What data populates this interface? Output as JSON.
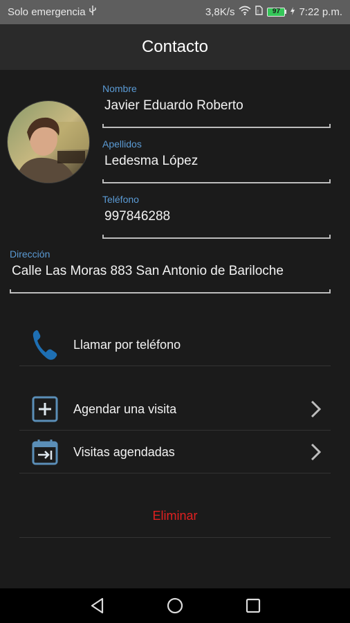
{
  "status_bar": {
    "carrier": "Solo emergencia",
    "speed": "3,8K/s",
    "battery": "97",
    "battery_level": 0.97,
    "time": "7:22 p.m."
  },
  "header": {
    "title": "Contacto"
  },
  "avatar": {
    "icon": "avatar-photo"
  },
  "fields": {
    "nombre": {
      "label": "Nombre",
      "value": "Javier Eduardo Roberto"
    },
    "apellidos": {
      "label": "Apellidos",
      "value": "Ledesma López"
    },
    "telefono": {
      "label": "Teléfono",
      "value": "997846288"
    },
    "direccion": {
      "label": "Dirección",
      "value": "Calle Las Moras 883 San Antonio de Bariloche"
    }
  },
  "actions": {
    "call": {
      "label": "Llamar por teléfono",
      "icon": "phone-icon"
    },
    "schedule": {
      "label": "Agendar una visita",
      "icon": "add-box-icon"
    },
    "scheduled": {
      "label": "Visitas agendadas",
      "icon": "calendar-icon"
    },
    "delete": {
      "label": "Eliminar"
    }
  },
  "colors": {
    "accent_label": "#5b9bd5",
    "phone_icon": "#1e6fb3",
    "delete": "#e02020",
    "background": "#1b1b1b"
  }
}
